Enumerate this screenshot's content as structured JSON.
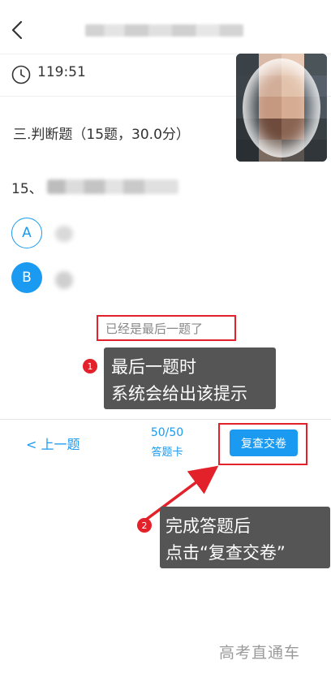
{
  "header": {
    "back_icon": "chevron-left-icon"
  },
  "timer": {
    "icon": "clock-icon",
    "remaining": "119:51"
  },
  "question": {
    "section_title": "三.判断题（15题，30.0分）",
    "number_prefix": "15、",
    "options": [
      {
        "letter": "A",
        "selected": false
      },
      {
        "letter": "B",
        "selected": true
      }
    ]
  },
  "notice": {
    "text": "已经是最后一题了"
  },
  "annotations": [
    {
      "badge": "1",
      "lines": [
        "最后一题时",
        "系统会给出该提示"
      ]
    },
    {
      "badge": "2",
      "lines": [
        "完成答题后",
        "点击“复查交卷”"
      ]
    }
  ],
  "bottom_nav": {
    "prev_label": "< 上一题",
    "progress": "50/50",
    "card_label": "答题卡",
    "submit_label": "复查交卷"
  },
  "watermark": "高考直通车",
  "colors": {
    "accent": "#1a9af0",
    "highlight": "#e3212a",
    "callout_bg": "#555555"
  }
}
